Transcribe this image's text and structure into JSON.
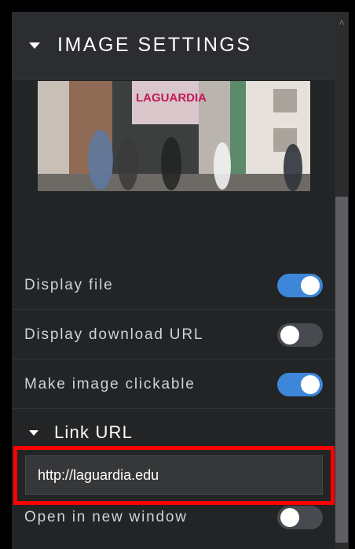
{
  "panel": {
    "title": "IMAGE SETTINGS",
    "preview": {
      "signage": "LAGUARDIA"
    },
    "toggles": [
      {
        "label": "Display file",
        "state": "on"
      },
      {
        "label": "Display download URL",
        "state": "off"
      },
      {
        "label": "Make image clickable",
        "state": "on"
      }
    ],
    "link_url": {
      "heading": "Link URL",
      "value": "http://laguardia.edu"
    },
    "open_new_window": {
      "label": "Open in new window",
      "state": "off"
    }
  },
  "icons": {
    "collapse": "caret-down-icon",
    "scroll_up": "chevron-up-icon"
  },
  "colors": {
    "toggle_on": "#3d86d9",
    "toggle_off": "#474a4e",
    "highlight": "#ff0000"
  }
}
